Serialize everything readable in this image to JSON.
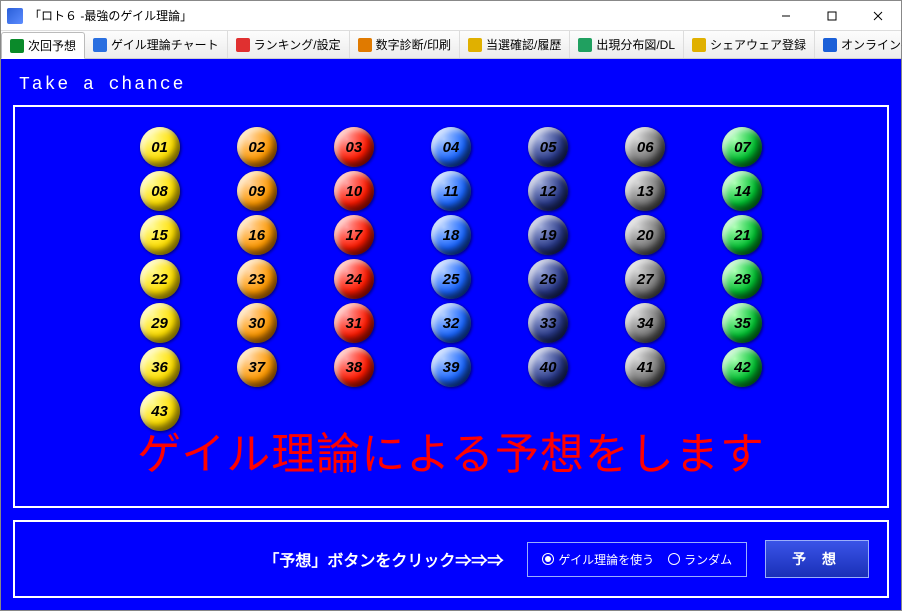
{
  "window": {
    "title": "「ロト６ -最強のゲイル理論」"
  },
  "tabs": [
    {
      "label": "次回予想",
      "icon_color": "#0a8a2a"
    },
    {
      "label": "ゲイル理論チャート",
      "icon_color": "#2a6fe0"
    },
    {
      "label": "ランキング/設定",
      "icon_color": "#e03030"
    },
    {
      "label": "数字診断/印刷",
      "icon_color": "#e07a00"
    },
    {
      "label": "当選確認/履歴",
      "icon_color": "#e0b000"
    },
    {
      "label": "出現分布図/DL",
      "icon_color": "#20a060"
    },
    {
      "label": "シェアウェア登録",
      "icon_color": "#e0b000"
    },
    {
      "label": "オンラインヘルプ",
      "icon_color": "#1a5fd8"
    }
  ],
  "chance_label": "Take a chance",
  "balls": [
    {
      "n": "01",
      "c": "yellow"
    },
    {
      "n": "02",
      "c": "orange"
    },
    {
      "n": "03",
      "c": "red"
    },
    {
      "n": "04",
      "c": "blue"
    },
    {
      "n": "05",
      "c": "navy"
    },
    {
      "n": "06",
      "c": "gray"
    },
    {
      "n": "07",
      "c": "green"
    },
    {
      "n": "08",
      "c": "yellow"
    },
    {
      "n": "09",
      "c": "orange"
    },
    {
      "n": "10",
      "c": "red"
    },
    {
      "n": "11",
      "c": "blue"
    },
    {
      "n": "12",
      "c": "navy"
    },
    {
      "n": "13",
      "c": "gray"
    },
    {
      "n": "14",
      "c": "green"
    },
    {
      "n": "15",
      "c": "yellow"
    },
    {
      "n": "16",
      "c": "orange"
    },
    {
      "n": "17",
      "c": "red"
    },
    {
      "n": "18",
      "c": "blue"
    },
    {
      "n": "19",
      "c": "navy"
    },
    {
      "n": "20",
      "c": "gray"
    },
    {
      "n": "21",
      "c": "green"
    },
    {
      "n": "22",
      "c": "yellow"
    },
    {
      "n": "23",
      "c": "orange"
    },
    {
      "n": "24",
      "c": "red"
    },
    {
      "n": "25",
      "c": "blue"
    },
    {
      "n": "26",
      "c": "navy"
    },
    {
      "n": "27",
      "c": "gray"
    },
    {
      "n": "28",
      "c": "green"
    },
    {
      "n": "29",
      "c": "yellow"
    },
    {
      "n": "30",
      "c": "orange"
    },
    {
      "n": "31",
      "c": "red"
    },
    {
      "n": "32",
      "c": "blue"
    },
    {
      "n": "33",
      "c": "navy"
    },
    {
      "n": "34",
      "c": "gray"
    },
    {
      "n": "35",
      "c": "green"
    },
    {
      "n": "36",
      "c": "yellow"
    },
    {
      "n": "37",
      "c": "orange"
    },
    {
      "n": "38",
      "c": "red"
    },
    {
      "n": "39",
      "c": "blue"
    },
    {
      "n": "40",
      "c": "navy"
    },
    {
      "n": "41",
      "c": "gray"
    },
    {
      "n": "42",
      "c": "green"
    },
    {
      "n": "43",
      "c": "yellow"
    }
  ],
  "overlay": "ゲイル理論による予想をします",
  "footer": {
    "prompt": "「予想」ボタンをクリック⇒⇒⇒",
    "option_gale": "ゲイル理論を使う",
    "option_random": "ランダム",
    "button": "予 想"
  }
}
